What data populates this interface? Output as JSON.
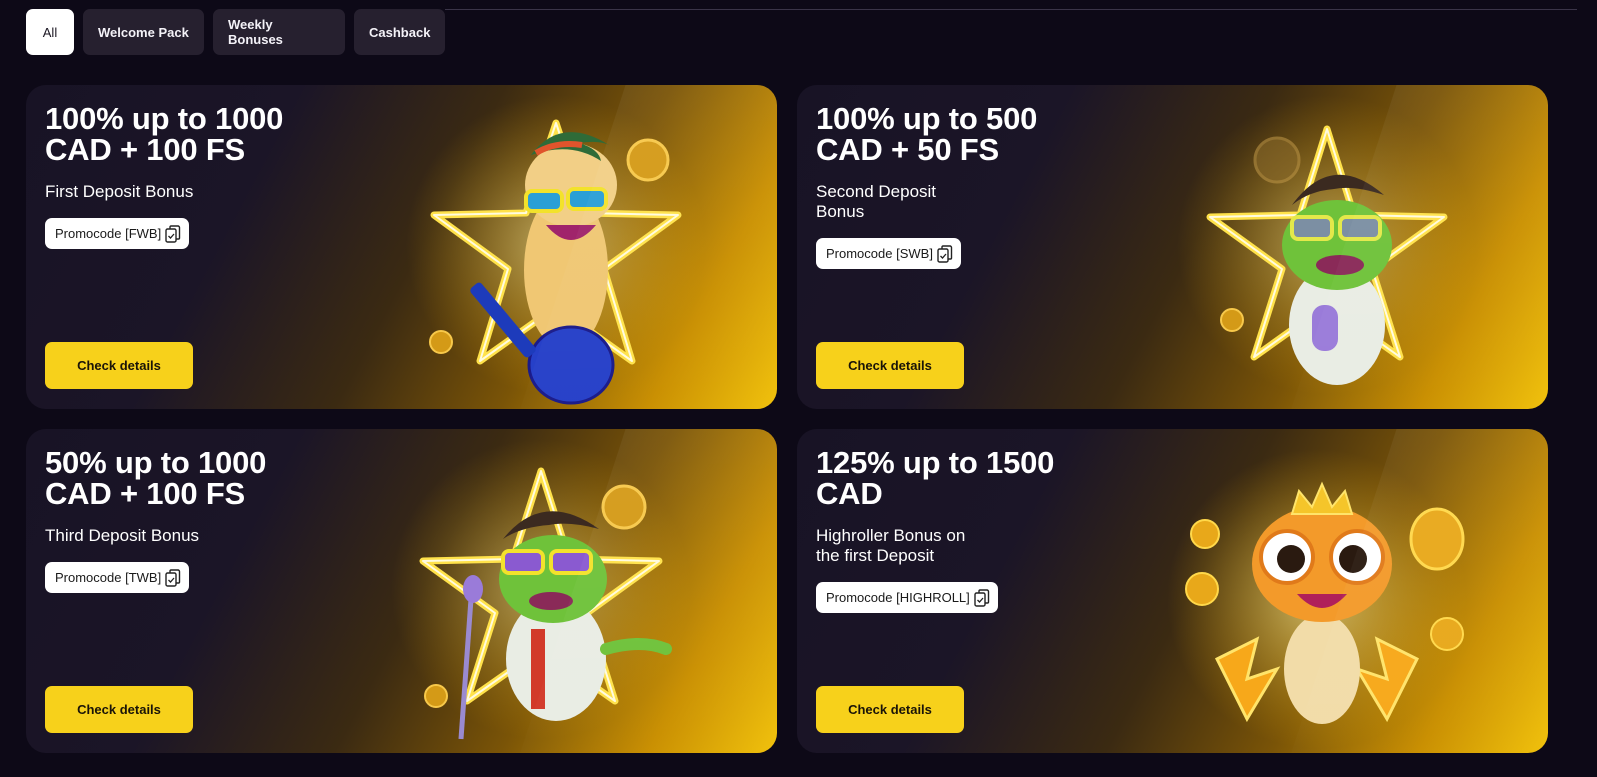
{
  "tabs": [
    {
      "label": "All",
      "active": true
    },
    {
      "label": "Welcome Pack",
      "active": false
    },
    {
      "label": "Weekly Bonuses",
      "active": false
    },
    {
      "label": "Cashback",
      "active": false
    }
  ],
  "cards": [
    {
      "title_line1": "100% up to 1000",
      "title_line2": "CAD + 100 FS",
      "subtitle": "First Deposit Bonus",
      "promo": "Promocode [FWB]",
      "button": "Check details",
      "art_icon": "frog-guitar-star-icon"
    },
    {
      "title_line1": "100% up to 500",
      "title_line2": "CAD + 50 FS",
      "subtitle": "Second Deposit Bonus",
      "promo": "Promocode [SWB]",
      "button": "Check details",
      "art_icon": "frog-microphone-star-icon"
    },
    {
      "title_line1": "50% up to 1000",
      "title_line2": "CAD + 100 FS",
      "subtitle": "Third Deposit Bonus",
      "promo": "Promocode [TWB]",
      "button": "Check details",
      "art_icon": "frog-singer-star-icon"
    },
    {
      "title_line1": "125% up to 1500",
      "title_line2": "CAD",
      "subtitle": "Highroller Bonus on the first Deposit",
      "promo": "Promocode [HIGHROLL]",
      "button": "Check details",
      "art_icon": "frog-crown-coins-icon"
    }
  ],
  "colors": {
    "background": "#0d0917",
    "accent": "#f7d11b",
    "tab_bg": "#26202f"
  }
}
